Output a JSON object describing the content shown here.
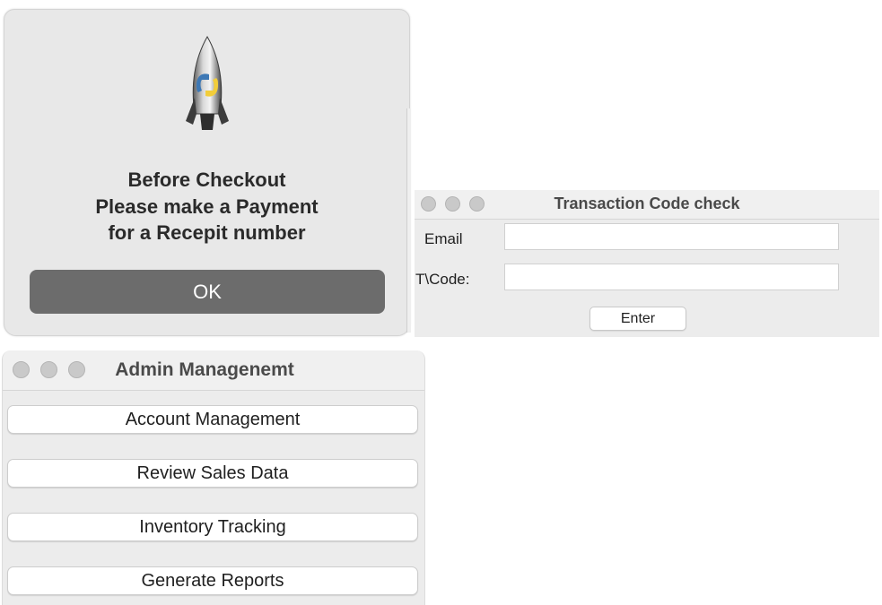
{
  "alert": {
    "icon": "python-launcher-rocket-icon",
    "message_lines": [
      "Before Checkout",
      "Please make a Payment",
      "for a Recepit number"
    ],
    "ok_label": "OK"
  },
  "transaction_window": {
    "title": "Transaction Code check",
    "email_label": "Email",
    "email_value": "",
    "code_label": "T\\Code:",
    "code_value": "",
    "enter_label": "Enter"
  },
  "admin_window": {
    "title": "Admin Managenemt",
    "buttons": [
      "Account Management",
      "Review Sales Data",
      "Inventory Tracking",
      "Generate Reports"
    ]
  },
  "colors": {
    "ok_button": "#6c6c6c",
    "window_bg": "#ececec",
    "traffic_light": "#c9c9c9"
  }
}
